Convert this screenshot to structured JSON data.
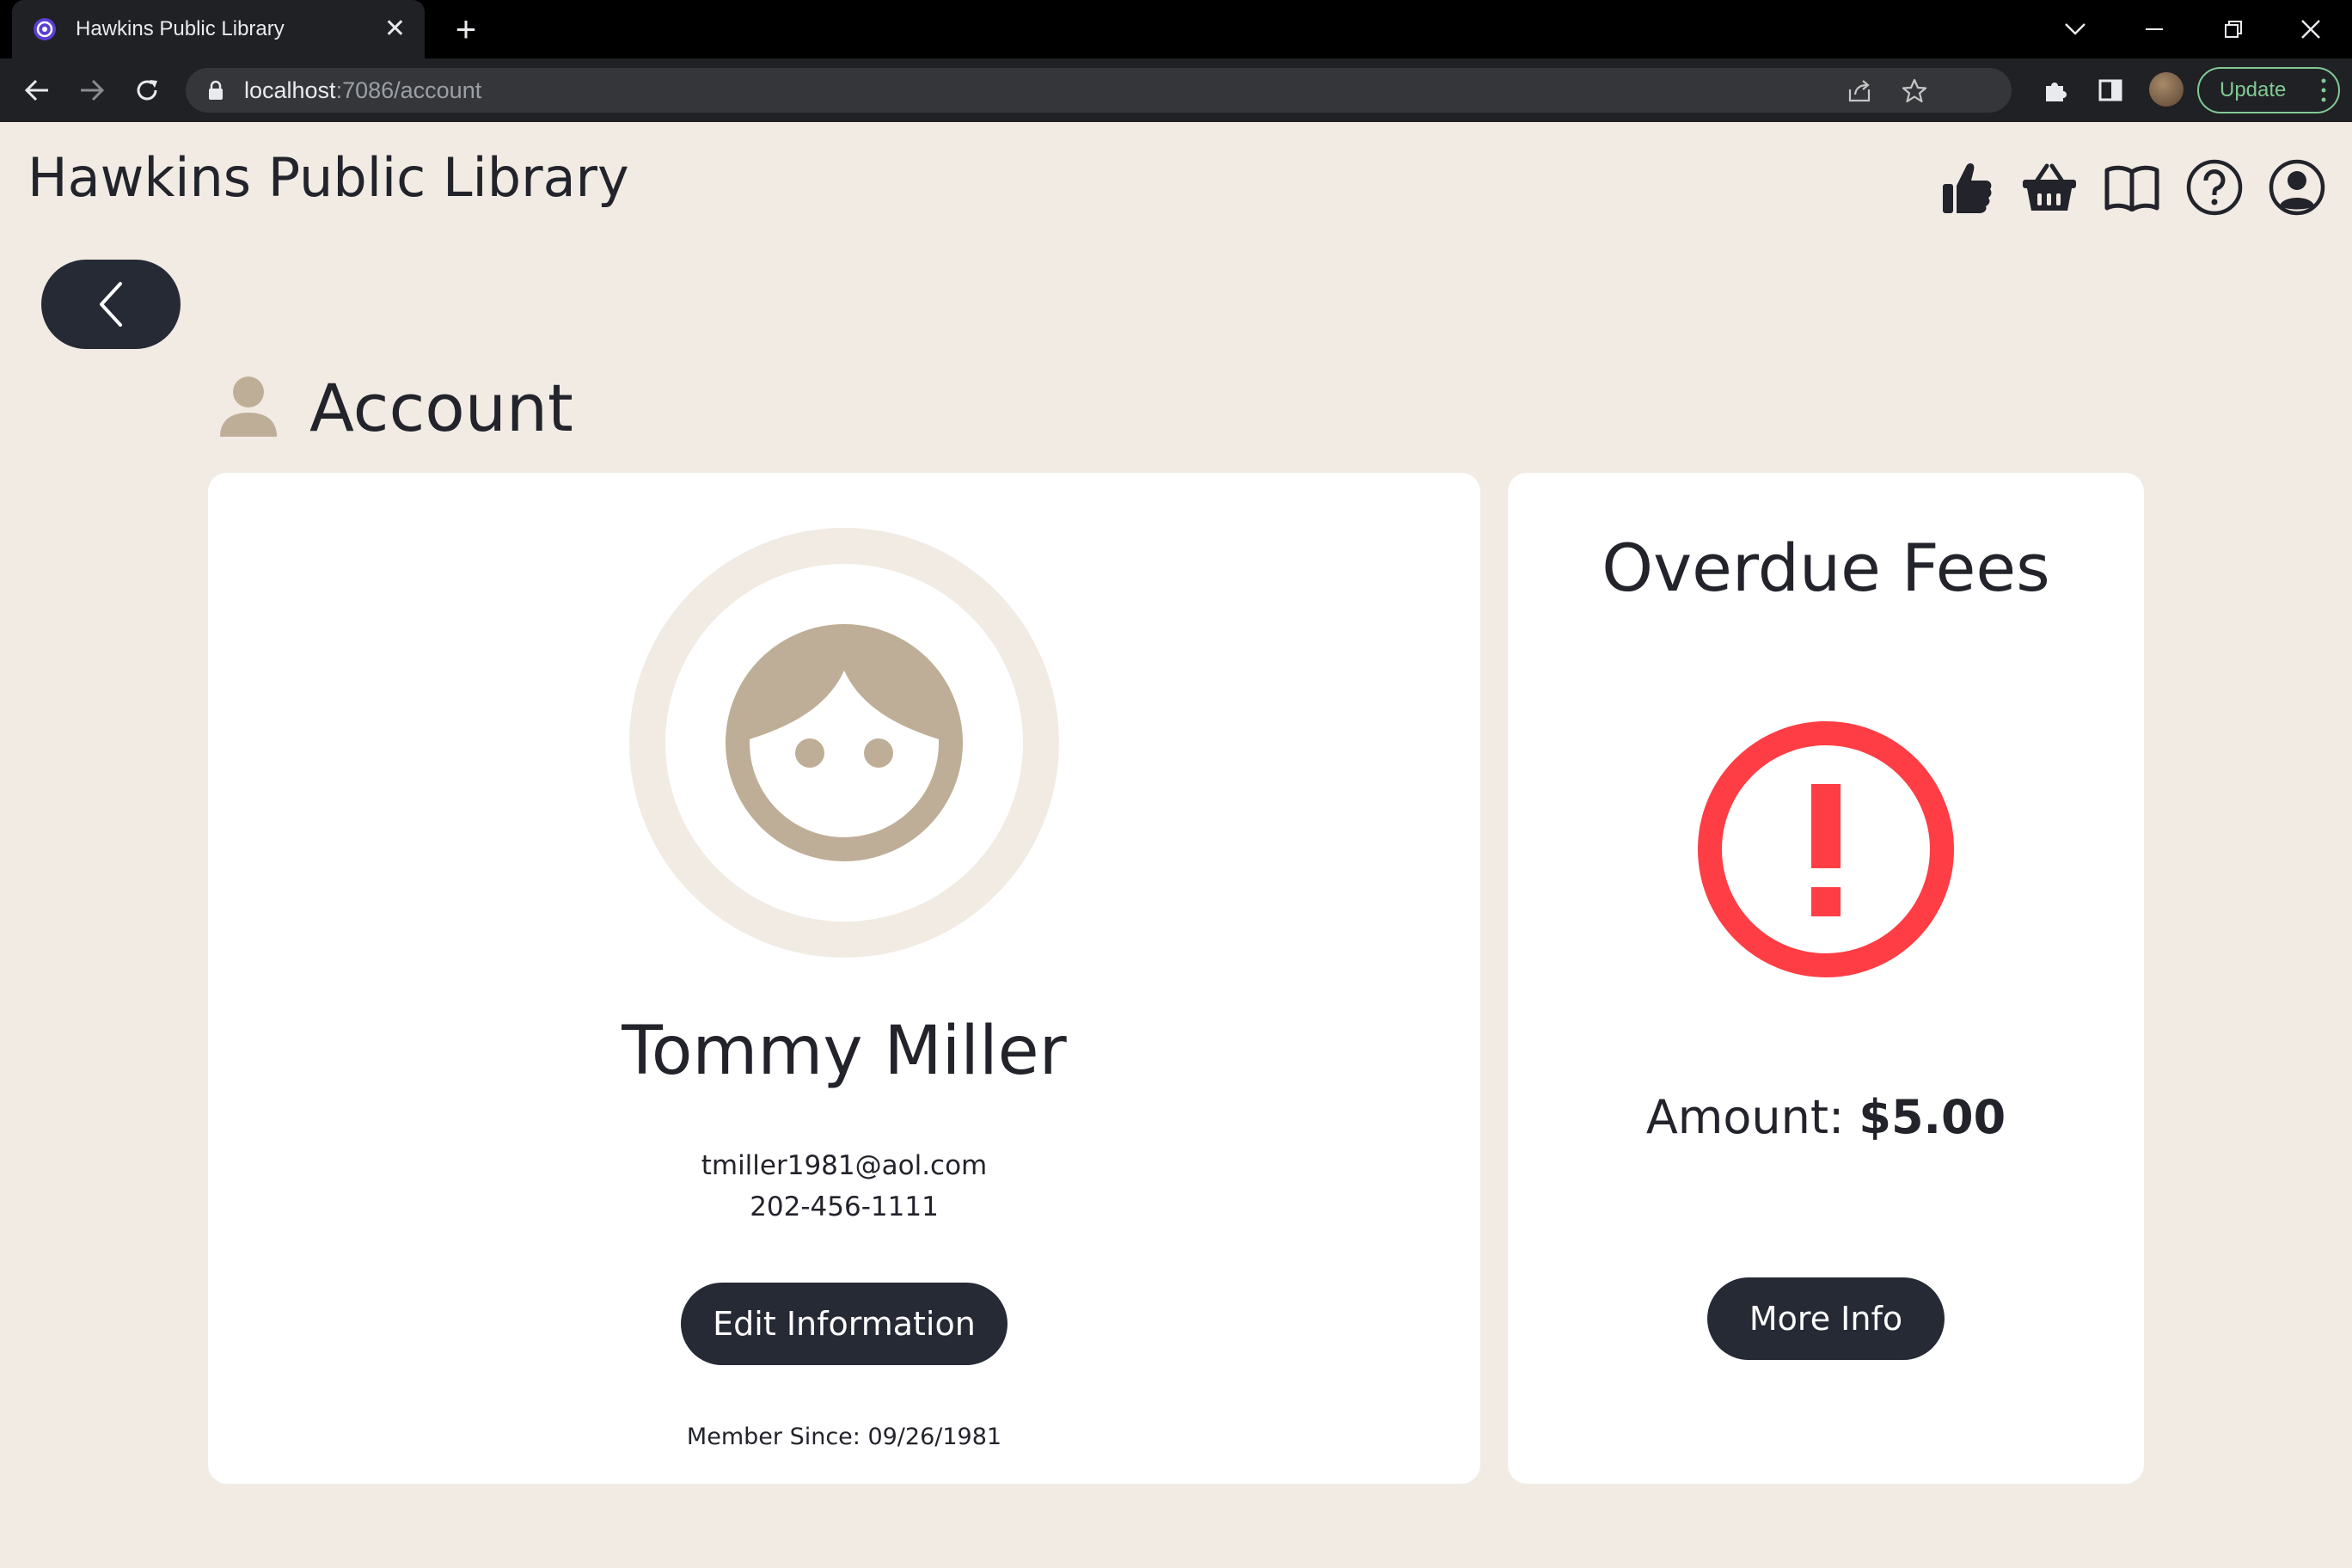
{
  "browser": {
    "tab_title": "Hawkins Public Library",
    "url_host": "localhost",
    "url_path": ":7086/account",
    "update_label": "Update"
  },
  "header": {
    "site_title": "Hawkins Public Library"
  },
  "account": {
    "heading": "Account",
    "profile": {
      "name": "Tommy Miller",
      "email": "tmiller1981@aol.com",
      "phone": "202-456-1111",
      "edit_label": "Edit Information",
      "member_since": "Member Since: 09/26/1981"
    },
    "fees": {
      "title": "Overdue Fees",
      "amount_label": "Amount: ",
      "amount_value": "$5.00",
      "more_label": "More Info"
    }
  },
  "colors": {
    "background": "#f1ebe4",
    "accent_dark": "#252a35",
    "avatar_tan": "#bfae97",
    "alert_red": "#ff3d44"
  }
}
